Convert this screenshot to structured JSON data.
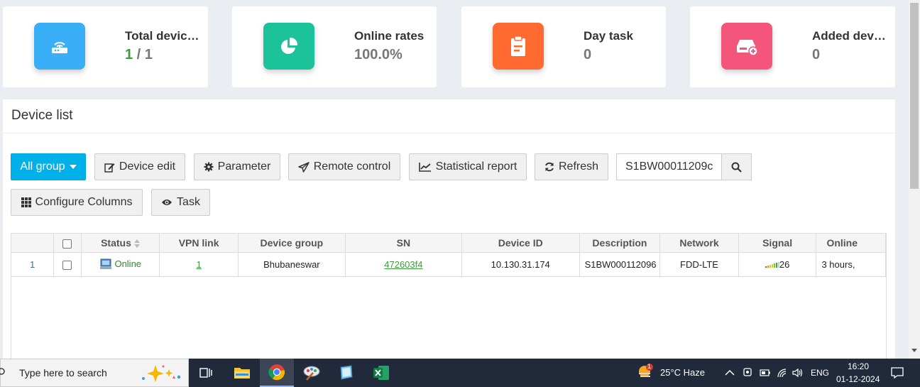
{
  "colors": {
    "tile_blue": "#3aaef6",
    "tile_green": "#1cc39a",
    "tile_orange": "#ff6a31",
    "tile_pink": "#f3567a",
    "accent": "#00b0e8"
  },
  "cards": [
    {
      "title": "Total devic…",
      "value_online": "1",
      "value_total": " / 1",
      "icon": "router-icon"
    },
    {
      "title": "Online rates",
      "value": "100.0%",
      "icon": "pie-chart-icon"
    },
    {
      "title": "Day task",
      "value": "0",
      "icon": "clipboard-icon"
    },
    {
      "title": "Added dev…",
      "value": "0",
      "icon": "add-device-icon"
    }
  ],
  "panel": {
    "title": "Device list"
  },
  "toolbar": {
    "all_group": "All group",
    "device_edit": "Device edit",
    "parameter": "Parameter",
    "remote_control": "Remote control",
    "statistical_report": "Statistical report",
    "refresh": "Refresh",
    "search_value": "S1BW00011209с",
    "configure_columns": "Configure Columns",
    "task": "Task"
  },
  "table": {
    "headers": [
      "",
      "",
      "Status",
      "VPN link",
      "Device group",
      "SN",
      "Device ID",
      "Description",
      "Network",
      "Signal",
      "Online"
    ],
    "rows": [
      {
        "index": "1",
        "status": "Online",
        "vpn_link": "1",
        "device_group": "Bhubaneswar",
        "sn": "472603f4",
        "device_id": "10.130.31.174",
        "description": "S1BW000112096",
        "network": "FDD-LTE",
        "signal": "26",
        "online": "3 hours,"
      }
    ]
  },
  "taskbar": {
    "search_placeholder": "Type here to search",
    "weather": "25°C  Haze",
    "language": "ENG",
    "time": "16:20",
    "date": "01-12-2024",
    "weather_badge": "1"
  }
}
